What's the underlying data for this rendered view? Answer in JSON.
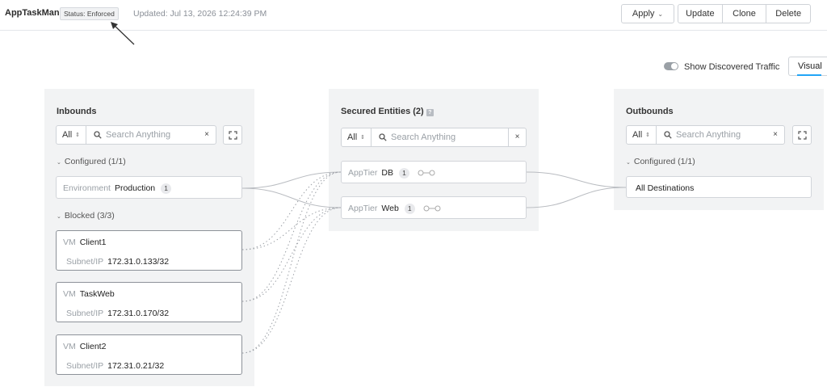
{
  "header": {
    "app_name": "AppTaskMan",
    "status": "Status: Enforced",
    "updated": "Updated: Jul 13, 2026 12:24:39 PM",
    "buttons": {
      "apply": "Apply",
      "update": "Update",
      "clone": "Clone",
      "delete": "Delete"
    }
  },
  "toolbar": {
    "toggle_label": "Show Discovered Traffic",
    "toggle_on": false,
    "view_tab": "Visual"
  },
  "search": {
    "filter": "All",
    "placeholder": "Search Anything",
    "clear": "×"
  },
  "inbounds": {
    "title": "Inbounds",
    "configured": {
      "label": "Configured (1/1)",
      "items": [
        {
          "type": "Environment",
          "name": "Production",
          "count": "1"
        }
      ]
    },
    "blocked": {
      "label": "Blocked (3/3)",
      "items": [
        {
          "type": "VM",
          "name": "Client1",
          "ip_label": "Subnet/IP",
          "ip": "172.31.0.133/32"
        },
        {
          "type": "VM",
          "name": "TaskWeb",
          "ip_label": "Subnet/IP",
          "ip": "172.31.0.170/32"
        },
        {
          "type": "VM",
          "name": "Client2",
          "ip_label": "Subnet/IP",
          "ip": "172.31.0.21/32"
        }
      ]
    }
  },
  "secured": {
    "title": "Secured Entities (2)",
    "help": "?",
    "items": [
      {
        "type": "AppTier",
        "name": "DB",
        "count": "1"
      },
      {
        "type": "AppTier",
        "name": "Web",
        "count": "1"
      }
    ]
  },
  "outbounds": {
    "title": "Outbounds",
    "configured": {
      "label": "Configured (1/1)",
      "items": [
        {
          "name": "All Destinations"
        }
      ]
    }
  },
  "colors": {
    "accent": "#22a5f7",
    "panel_bg": "#f2f3f4",
    "border": "#cfd3d8",
    "link_line": "#b9bcc1"
  }
}
